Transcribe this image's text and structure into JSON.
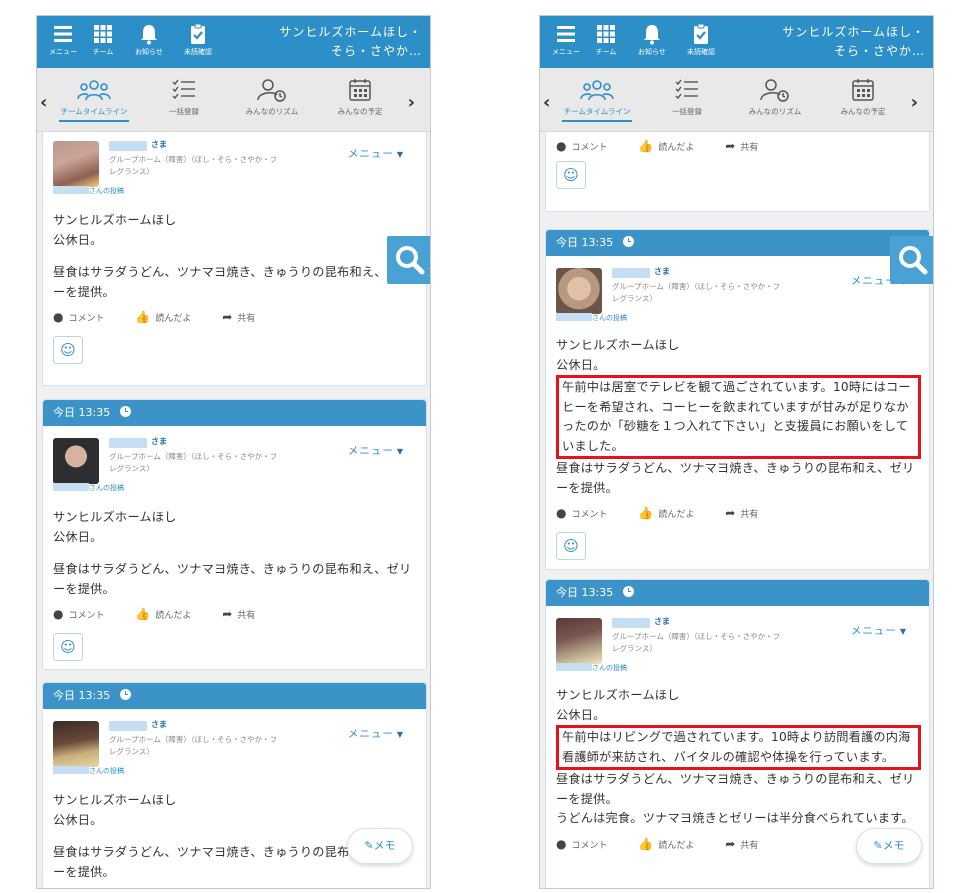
{
  "header": {
    "title": "サンヒルズホームほし・そら・さやか…",
    "menu_label": "メニュー",
    "team_label": "チーム",
    "notice_label": "お知らせ",
    "unread_label": "未読確認"
  },
  "tabs": [
    {
      "label": "チームタイムライン",
      "icon": "people-icon",
      "active": true
    },
    {
      "label": "一括登録",
      "icon": "checklist-icon",
      "active": false
    },
    {
      "label": "みんなのリズム",
      "icon": "person-clock-icon",
      "active": false
    },
    {
      "label": "みんなの予定",
      "icon": "calendar-icon",
      "active": false
    }
  ],
  "common": {
    "sama": "さま",
    "group": "グループホーム（障害）（ほし・そら・さやか・フレグランス）",
    "menu": "メニュー",
    "posted_by": "さんの投稿",
    "comment": "コメント",
    "like": "読んだよ",
    "share": "共有",
    "timestamp": "今日 13:35",
    "memo": "メモ"
  },
  "left_posts": [
    {
      "lines": [
        "サンヒルズホームほし",
        "公休日。",
        "",
        "昼食はサラダうどん、ツナマヨ焼き、きゅうりの昆布和え、ゼリーを提供。"
      ]
    },
    {
      "lines": [
        "サンヒルズホームほし",
        "公休日。",
        "",
        "昼食はサラダうどん、ツナマヨ焼き、きゅうりの昆布和え、ゼリーを提供。"
      ]
    },
    {
      "lines": [
        "サンヒルズホームほし",
        "公休日。",
        "",
        "昼食はサラダうどん、ツナマヨ焼き、きゅうりの昆布和え、ゼリーを提供。"
      ]
    }
  ],
  "right_posts": [
    {
      "pre": [
        "サンヒルズホームほし",
        "公休日。"
      ],
      "highlight": "午前中は居室でテレビを観て過ごされています。10時にはコーヒーを希望され、コーヒーを飲まれていますが甘みが足りなかったのか「砂糖を１つ入れて下さい」と支援員にお願いをしていました。",
      "post": [
        "昼食はサラダうどん、ツナマヨ焼き、きゅうりの昆布和え、ゼリーを提供。"
      ]
    },
    {
      "pre": [
        "サンヒルズホームほし",
        "公休日。"
      ],
      "highlight": "午前中はリビングで過されています。10時より訪問看護の内海看護師が来訪され、バイタルの確認や体操を行っています。",
      "post": [
        "昼食はサラダうどん、ツナマヨ焼き、きゅうりの昆布和え、ゼリーを提供。",
        "うどんは完食。ツナマヨ焼きとゼリーは半分食べられています。"
      ]
    }
  ],
  "colors": {
    "accent": "#2d8fc7",
    "highlight_border": "#e8121c"
  }
}
